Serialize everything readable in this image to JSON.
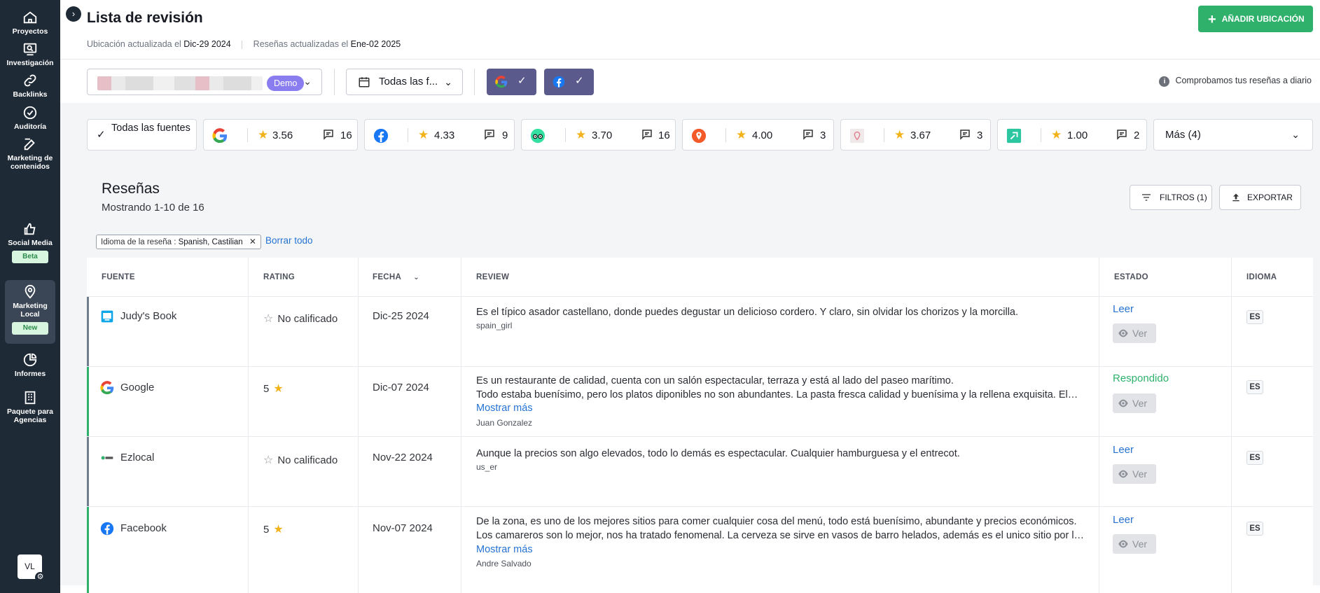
{
  "sidebar": {
    "items": [
      {
        "label": "Proyectos",
        "icon": "home-icon"
      },
      {
        "label": "Investigación",
        "icon": "research-icon"
      },
      {
        "label": "Backlinks",
        "icon": "link-icon"
      },
      {
        "label": "Auditoría",
        "icon": "check-circle-icon"
      },
      {
        "label": "Marketing de contenidos",
        "icon": "edit-icon"
      },
      {
        "label": "Social Media",
        "icon": "thumbs-up-icon",
        "badge": "Beta"
      },
      {
        "label": "Marketing Local",
        "icon": "map-pin-icon",
        "badge": "New"
      },
      {
        "label": "Informes",
        "icon": "pie-chart-icon"
      },
      {
        "label": "Paquete para Agencias",
        "icon": "building-icon"
      }
    ],
    "avatar": "VL"
  },
  "header": {
    "title": "Lista de revisión",
    "location_updated_label": "Ubicación actualizada el",
    "location_updated_date": "Dic-29 2024",
    "reviews_updated_label": "Reseñas actualizadas el",
    "reviews_updated_date": "Ene-02 2025",
    "add_button": "AÑADIR UBICACIÓN"
  },
  "toolbar": {
    "location_badge": "Demo",
    "date_filter": "Todas las f...",
    "info_note": "Comprobamos tus reseñas a diario"
  },
  "sources": {
    "all_label": "Todas las fuentes",
    "cards": [
      {
        "name": "google",
        "rating": "3.56",
        "count": "16"
      },
      {
        "name": "facebook",
        "rating": "4.33",
        "count": "9"
      },
      {
        "name": "tripadvisor",
        "rating": "3.70",
        "count": "16"
      },
      {
        "name": "foursquare",
        "rating": "4.00",
        "count": "3"
      },
      {
        "name": "pin-source",
        "rating": "3.67",
        "count": "3"
      },
      {
        "name": "green-source",
        "rating": "1.00",
        "count": "2"
      }
    ],
    "more_label": "Más (4)"
  },
  "reviews": {
    "title": "Reseñas",
    "subtitle": "Mostrando 1-10 de 16",
    "filters_button": "FILTROS (1)",
    "export_button": "EXPORTAR",
    "filter_chip_label": "Idioma de la reseña :",
    "filter_chip_value": "Spanish, Castilian",
    "clear_all": "Borrar todo",
    "columns": {
      "source": "FUENTE",
      "rating": "RATING",
      "date": "FECHA",
      "review": "REVIEW",
      "state": "ESTADO",
      "language": "IDIOMA"
    },
    "rows": [
      {
        "source": "Judy's Book",
        "rating": "No calificado",
        "date": "Dic-25 2024",
        "text1": "Es el típico asador castellano, donde puedes degustar un delicioso cordero. Y claro, sin olvidar los chorizos y la morcilla.",
        "author": "spain_girl",
        "state": "Leer",
        "view": "Ver",
        "lang": "ES"
      },
      {
        "source": "Google",
        "rating": "5",
        "date": "Dic-07 2024",
        "text1": "Es un restaurante de calidad, cuenta con un salón espectacular, terraza y está al lado del paseo marítimo.",
        "text2": "Todo estaba buenísimo, pero los platos diponibles no son abundantes. La pasta fresca calidad y buenísima y la rellena exquisita. El postre también delicioso.",
        "more": "Mostrar más",
        "author": "Juan Gonzalez",
        "state": "Respondido",
        "view": "Ver",
        "lang": "ES"
      },
      {
        "source": "Ezlocal",
        "rating": "No calificado",
        "date": "Nov-22 2024",
        "text1": "Aunque la precios son algo elevados, todo lo demás es espectacular. Cualquier hamburguesa y el entrecot.",
        "author": "us_er",
        "state": "Leer",
        "view": "Ver",
        "lang": "ES"
      },
      {
        "source": "Facebook",
        "rating": "5",
        "date": "Nov-07 2024",
        "text1": "De la zona, es uno de los mejores sitios para comer cualquier cosa del menú, todo está buenísimo, abundante y precios económicos.",
        "text2": "Los camareros son lo mejor, nos ha tratado fenomenal. La cerveza se sirve en vasos de barro helados, además es el unico sitio por la zona que lo hace.",
        "more": "Mostrar más",
        "author": "Andre Salvado",
        "state": "Leer",
        "view": "Ver",
        "lang": "ES"
      }
    ]
  },
  "colors": {
    "sidebar_bg": "#1f2a37",
    "accent_green": "#2fb16b",
    "link_blue": "#2673d3",
    "demo_purple": "#8a7df0",
    "star": "#f1b21a"
  }
}
